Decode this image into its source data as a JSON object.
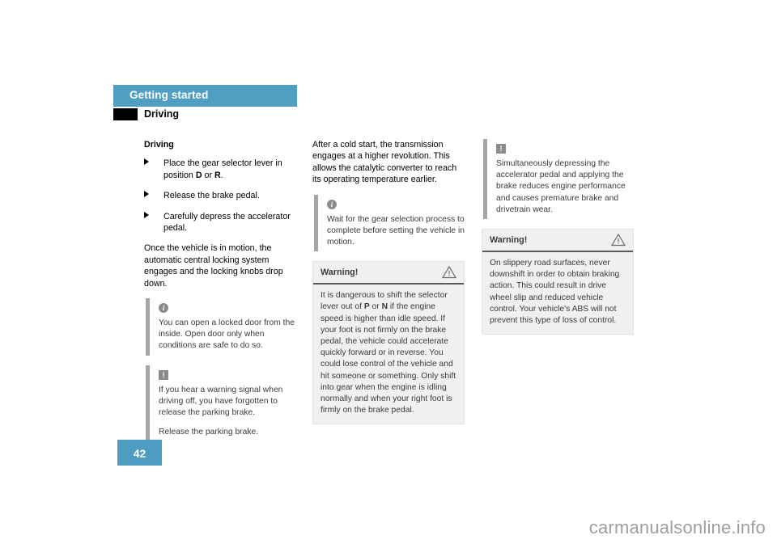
{
  "header": {
    "band_title": "Getting started",
    "subtitle": "Driving",
    "band_color": "#509ec1",
    "square_color": "#000000"
  },
  "columns": {
    "col1": {
      "heading": "Driving",
      "bullets": [
        "Place the gear selector lever in position D or R.",
        "Release the brake pedal.",
        "Carefully depress the accelerator pedal."
      ],
      "bullet_glyph": "triangle-right-bullet",
      "paragraph": "Once the vehicle is in motion, the automatic central locking system engages and the locking knobs drop down.",
      "note_info": {
        "icon": "info-icon",
        "text": "You can open a locked door from the inside. Open door only when conditions are safe to do so."
      },
      "note_caution": {
        "icon": "caution-icon",
        "text1": "If you hear a warning signal when driving off, you have forgotten to release the parking brake.",
        "text2": "Release the parking brake."
      }
    },
    "col2": {
      "paragraph": "After a cold start, the transmission engages at a higher revolution. This allows the catalytic converter to reach its operating temperature earlier.",
      "note_info": {
        "icon": "info-icon",
        "text": "Wait for the gear selection process to complete before setting the vehicle in motion."
      },
      "warning": {
        "title": "Warning!",
        "icon": "warning-triangle-icon",
        "text": "It is dangerous to shift the selector lever out of P or N if the engine speed is higher than idle speed. If your foot is not firmly on the brake pedal, the vehicle could accelerate quickly forward or in reverse. You could lose control of the vehicle and hit someone or something. Only shift into gear when the engine is idling normally and when your right foot is firmly on the brake pedal."
      }
    },
    "col3": {
      "note_caution": {
        "icon": "caution-icon",
        "text": "Simultaneously depressing the accelerator pedal and applying the brake reduces engine performance and causes premature brake and drivetrain wear."
      },
      "warning": {
        "title": "Warning!",
        "icon": "warning-triangle-icon",
        "text": "On slippery road surfaces, never downshift in order to obtain braking action. This could result in drive wheel slip and reduced vehicle control. Your vehicle's ABS will not prevent this type of loss of control."
      }
    }
  },
  "footer": {
    "page_number": "42",
    "page_number_color": "#4d9dc2",
    "watermark": "carmanualsonline.info"
  },
  "icons": {
    "info": "i",
    "caution": "!"
  }
}
